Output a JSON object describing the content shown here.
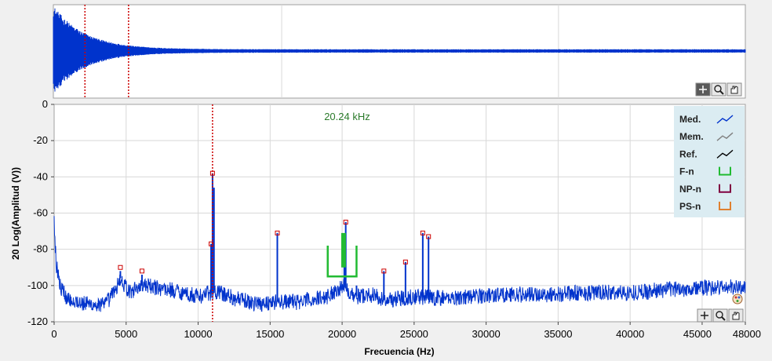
{
  "colors": {
    "measured": "#0033cc",
    "memory": "#808080",
    "reference": "#000000",
    "f_marker": "#22bb33",
    "np_marker": "#800040",
    "ps_marker": "#e08030",
    "cursor": "#cc0000",
    "peak_marker": "#cc0000",
    "annotation": "#2a7a2a",
    "legend_bg": "#dbecf2",
    "plot_bg": "#ffffff",
    "grid": "#d8d8d8"
  },
  "toolbar_icons": [
    "crosshair-icon",
    "zoom-icon",
    "pan-icon"
  ],
  "time_plot": {
    "cursors_fraction": [
      0.023,
      0.086
    ],
    "envelope": {
      "type": "decaying",
      "initial_amplitude": 1.0,
      "floor": 0.04
    }
  },
  "chart_data": {
    "type": "line",
    "xlabel": "Frecuencia (Hz)",
    "ylabel": "20 Log(Amplitud (V))",
    "xlim": [
      0,
      48000
    ],
    "ylim": [
      -120,
      0
    ],
    "x_ticks": [
      0,
      5000,
      10000,
      15000,
      20000,
      25000,
      30000,
      35000,
      40000,
      45000,
      48000
    ],
    "y_ticks": [
      0,
      -20,
      -40,
      -60,
      -80,
      -100,
      -120
    ],
    "grid": true,
    "legend_position": "top-right",
    "legend": [
      {
        "name": "Med.",
        "kind": "line",
        "color": "#0033cc"
      },
      {
        "name": "Mem.",
        "kind": "line",
        "color": "#808080"
      },
      {
        "name": "Ref.",
        "kind": "line",
        "color": "#000000"
      },
      {
        "name": "F-n",
        "kind": "bracket",
        "color": "#22bb33"
      },
      {
        "name": "NP-n",
        "kind": "bracket",
        "color": "#800040"
      },
      {
        "name": "PS-n",
        "kind": "bracket",
        "color": "#e08030"
      }
    ],
    "annotation": {
      "text": "20.24 kHz",
      "x": 20240
    },
    "cursor_x": 11000,
    "band": {
      "x_start": 19000,
      "x_end": 21000,
      "y_top": -78,
      "y_bottom": -95
    },
    "peaks": [
      {
        "x": 4600,
        "y": -90
      },
      {
        "x": 6100,
        "y": -92
      },
      {
        "x": 10900,
        "y": -77
      },
      {
        "x": 11000,
        "y": -38
      },
      {
        "x": 15500,
        "y": -71
      },
      {
        "x": 20250,
        "y": -65
      },
      {
        "x": 22900,
        "y": -92
      },
      {
        "x": 24400,
        "y": -87
      },
      {
        "x": 25600,
        "y": -71
      },
      {
        "x": 26000,
        "y": -73
      }
    ],
    "spectrum_envelope": [
      [
        0,
        -66
      ],
      [
        150,
        -88
      ],
      [
        400,
        -100
      ],
      [
        900,
        -107
      ],
      [
        2000,
        -110
      ],
      [
        3500,
        -111
      ],
      [
        4300,
        -102
      ],
      [
        4600,
        -96
      ],
      [
        5200,
        -104
      ],
      [
        6000,
        -100
      ],
      [
        7000,
        -101
      ],
      [
        8500,
        -103
      ],
      [
        10000,
        -106
      ],
      [
        10800,
        -104
      ],
      [
        11500,
        -104
      ],
      [
        12500,
        -107
      ],
      [
        14000,
        -110
      ],
      [
        15500,
        -109
      ],
      [
        17000,
        -109
      ],
      [
        19000,
        -106
      ],
      [
        20000,
        -100
      ],
      [
        21000,
        -106
      ],
      [
        22000,
        -105
      ],
      [
        23000,
        -108
      ],
      [
        25000,
        -106
      ],
      [
        27000,
        -107
      ],
      [
        29000,
        -106
      ],
      [
        31000,
        -105
      ],
      [
        34000,
        -105
      ],
      [
        37000,
        -104
      ],
      [
        40000,
        -104
      ],
      [
        43000,
        -102
      ],
      [
        46000,
        -101
      ],
      [
        48000,
        -101
      ]
    ],
    "spectral_lines": [
      {
        "x": 4600,
        "top": -92
      },
      {
        "x": 6100,
        "top": -94
      },
      {
        "x": 10900,
        "top": -77
      },
      {
        "x": 11000,
        "top": -38
      },
      {
        "x": 11100,
        "top": -46
      },
      {
        "x": 15500,
        "top": -71
      },
      {
        "x": 20150,
        "top": -72
      },
      {
        "x": 20250,
        "top": -65
      },
      {
        "x": 21000,
        "top": -100
      },
      {
        "x": 22900,
        "top": -92
      },
      {
        "x": 24400,
        "top": -87
      },
      {
        "x": 25600,
        "top": -71
      },
      {
        "x": 26000,
        "top": -73
      }
    ]
  }
}
